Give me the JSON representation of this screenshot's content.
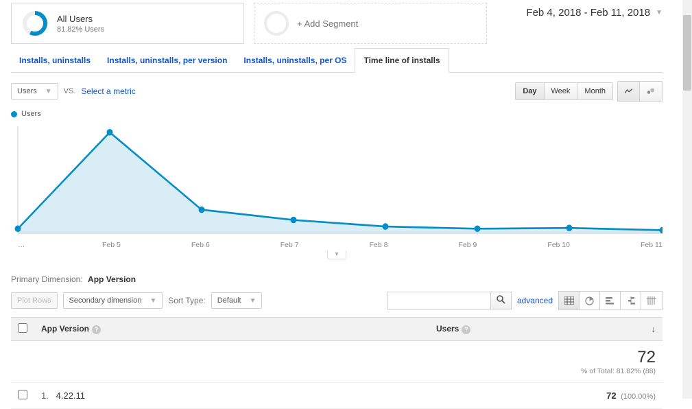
{
  "segment": {
    "title": "All Users",
    "sub": "81.82% Users",
    "add_label": "+ Add Segment"
  },
  "date_range": "Feb 4, 2018 - Feb 11, 2018",
  "tabs": {
    "t1": "Installs, uninstalls",
    "t2": "Installs, uninstalls, per version",
    "t3": "Installs, uninstalls, per OS",
    "t4": "Time line of installs"
  },
  "metric_bar": {
    "primary": "Users",
    "vs": "VS.",
    "select_metric": "Select a metric",
    "day": "Day",
    "week": "Week",
    "month": "Month"
  },
  "legend": {
    "label": "Users"
  },
  "primary_dimension": {
    "label": "Primary Dimension:",
    "value": "App Version"
  },
  "controls": {
    "plot_rows": "Plot Rows",
    "secondary_dim": "Secondary dimension",
    "sort_type_label": "Sort Type:",
    "sort_type_value": "Default",
    "advanced": "advanced"
  },
  "table": {
    "col1": "App Version",
    "col2": "Users",
    "summary_value": "72",
    "summary_sub": "% of Total: 81.82% (88)",
    "rows": [
      {
        "idx": "1.",
        "name": "4.22.11",
        "value": "72",
        "pct": "(100.00%)"
      }
    ]
  },
  "chart_data": {
    "type": "area",
    "title": "",
    "xlabel": "",
    "ylabel": "",
    "ylim": [
      0,
      50
    ],
    "categories": [
      "Feb 4",
      "Feb 5",
      "Feb 6",
      "Feb 7",
      "Feb 8",
      "Feb 9",
      "Feb 10",
      "Feb 11"
    ],
    "series": [
      {
        "name": "Users",
        "values": [
          2,
          46,
          11,
          6,
          3,
          2,
          2,
          1
        ]
      }
    ]
  },
  "xlabels": {
    "l0": "…",
    "l1": "Feb 5",
    "l2": "Feb 6",
    "l3": "Feb 7",
    "l4": "Feb 8",
    "l5": "Feb 9",
    "l6": "Feb 10",
    "l7": "Feb 11"
  }
}
